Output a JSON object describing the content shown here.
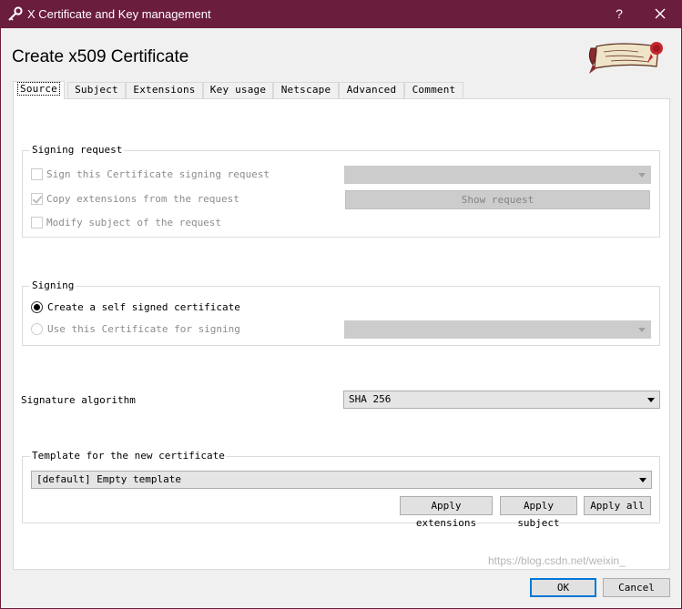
{
  "window": {
    "title": "X Certificate and Key management",
    "help_label": "?"
  },
  "heading": "Create x509 Certificate",
  "tabs": [
    {
      "label": "Source",
      "active": true
    },
    {
      "label": "Subject",
      "active": false
    },
    {
      "label": "Extensions",
      "active": false
    },
    {
      "label": "Key usage",
      "active": false
    },
    {
      "label": "Netscape",
      "active": false
    },
    {
      "label": "Advanced",
      "active": false
    },
    {
      "label": "Comment",
      "active": false
    }
  ],
  "signing_request": {
    "title": "Signing request",
    "sign_csr": {
      "label": "Sign this Certificate signing request",
      "checked": false,
      "enabled": false
    },
    "copy_extensions": {
      "label": "Copy extensions from the request",
      "checked": true,
      "enabled": false
    },
    "modify_subject": {
      "label": "Modify subject of the request",
      "checked": false,
      "enabled": false
    },
    "request_select": {
      "value": "",
      "enabled": false
    },
    "show_request_label": "Show request"
  },
  "signing": {
    "title": "Signing",
    "self_signed": {
      "label": "Create a self signed certificate",
      "selected": true
    },
    "use_certificate": {
      "label": "Use this Certificate for signing",
      "selected": false,
      "enabled": false
    },
    "ca_select": {
      "value": "",
      "enabled": false
    }
  },
  "signature_algorithm": {
    "label": "Signature algorithm",
    "value": "SHA 256"
  },
  "template": {
    "title": "Template for the new certificate",
    "value": "[default] Empty template",
    "apply_extensions_label": "Apply extensions",
    "apply_subject_label": "Apply subject",
    "apply_all_label": "Apply all"
  },
  "footer": {
    "ok_label": "OK",
    "cancel_label": "Cancel"
  },
  "watermark": "https://blog.csdn.net/weixin_"
}
